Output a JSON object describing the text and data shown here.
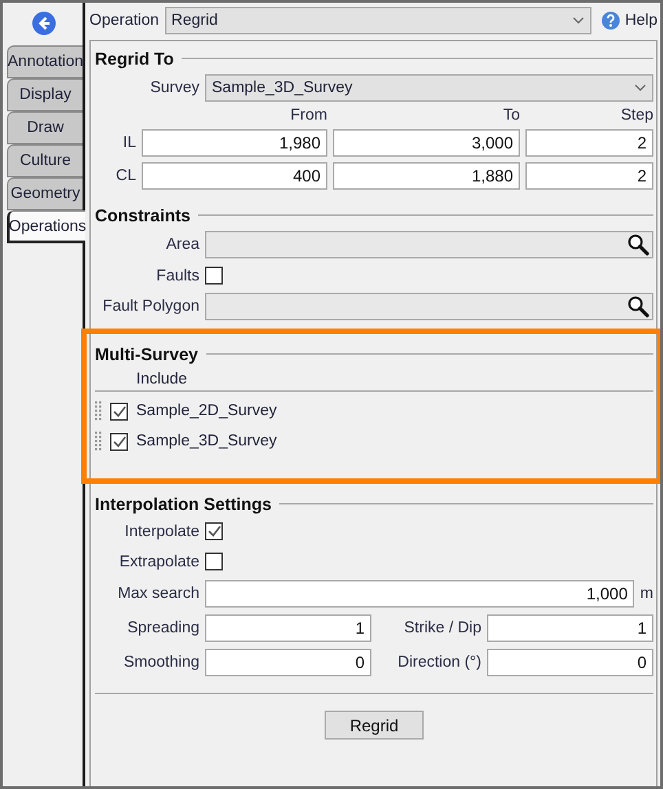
{
  "sidebar": {
    "tabs": [
      {
        "label": "Annotation",
        "selected": false
      },
      {
        "label": "Display",
        "selected": false
      },
      {
        "label": "Draw",
        "selected": false
      },
      {
        "label": "Culture",
        "selected": false
      },
      {
        "label": "Geometry",
        "selected": false
      },
      {
        "label": "Operations",
        "selected": true
      }
    ]
  },
  "operation": {
    "label": "Operation",
    "value": "Regrid",
    "help": "Help"
  },
  "regrid_to": {
    "title": "Regrid To",
    "survey_label": "Survey",
    "survey": "Sample_3D_Survey",
    "columns": [
      "From",
      "To",
      "Step"
    ],
    "rows": [
      {
        "label": "IL",
        "values": [
          "1,980",
          "3,000",
          "2"
        ]
      },
      {
        "label": "CL",
        "values": [
          "400",
          "1,880",
          "2"
        ]
      }
    ]
  },
  "constraints": {
    "title": "Constraints",
    "area_label": "Area",
    "faults_label": "Faults",
    "faults_checked": false,
    "fault_polygon_label": "Fault Polygon"
  },
  "multi_survey": {
    "title": "Multi-Survey",
    "column": "Include",
    "highlighted": true,
    "surveys": [
      {
        "name": "Sample_2D_Survey",
        "checked": true
      },
      {
        "name": "Sample_3D_Survey",
        "checked": true
      }
    ]
  },
  "interpolation": {
    "title": "Interpolation Settings",
    "interpolate_label": "Interpolate",
    "interpolate_checked": true,
    "extrapolate_label": "Extrapolate",
    "extrapolate_checked": false,
    "max_search_label": "Max search",
    "max_search": "1,000",
    "max_search_unit": "m",
    "spreading_label": "Spreading",
    "spreading": "1",
    "strike_dip_label": "Strike / Dip",
    "strike_dip": "1",
    "smoothing_label": "Smoothing",
    "smoothing": "0",
    "direction_label": "Direction (°)",
    "direction": "0"
  },
  "action": "Regrid"
}
